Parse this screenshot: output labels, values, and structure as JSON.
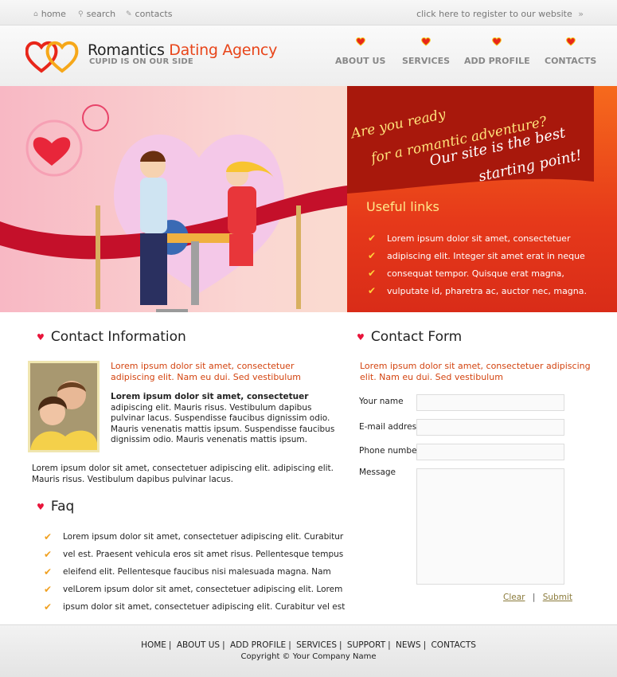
{
  "topbar": {
    "links": [
      {
        "label": "home",
        "icon": "home-icon"
      },
      {
        "label": "search",
        "icon": "search-icon"
      },
      {
        "label": "contacts",
        "icon": "pencil-icon"
      }
    ],
    "register": "click here to register to our website",
    "register_icon": "»"
  },
  "header": {
    "logo_title_a": "Romantics",
    "logo_title_b": "Dating Agency",
    "logo_sub": "CUPID IS ON OUR SIDE",
    "nav": [
      "ABOUT US",
      "SERVICES",
      "ADD PROFILE",
      "CONTACTS"
    ]
  },
  "banner": {
    "tagline": [
      "Are you ready",
      "for a romantic adventure?",
      "Our site is the best",
      "starting point!"
    ],
    "useful_title": "Useful links",
    "useful_links": [
      "Lorem ipsum dolor sit amet, consectetuer",
      "adipiscing elit. Integer sit amet erat in neque",
      "consequat tempor. Quisque erat magna,",
      "vulputate id, pharetra ac, auctor nec, magna."
    ]
  },
  "contact_info": {
    "title": "Contact Information",
    "intro": [
      "Lorem ipsum dolor sit amet, consectetuer",
      "adipiscing elit. Nam eu dui. Sed vestibulum"
    ],
    "bold": "Lorem ipsum dolor sit amet, consectetuer",
    "paragraph": [
      "adipiscing elit. Mauris risus. Vestibulum dapibus",
      "pulvinar lacus. Suspendisse faucibus dignissim odio.",
      "Mauris venenatis mattis ipsum.  Suspendisse faucibus",
      "dignissim odio. Mauris venenatis mattis ipsum."
    ],
    "extra": [
      "Lorem ipsum dolor sit amet, consectetuer adipiscing elit. adipiscing elit.",
      "Mauris risus. Vestibulum dapibus pulvinar lacus."
    ]
  },
  "faq": {
    "title": "Faq",
    "items": [
      "Lorem ipsum dolor sit amet, consectetuer adipiscing elit. Curabitur",
      "vel est. Praesent vehicula eros sit amet risus. Pellentesque tempus",
      "eleifend elit. Pellentesque faucibus nisi malesuada magna. Nam",
      "velLorem ipsum dolor sit amet, consectetuer adipiscing elit. Lorem",
      "ipsum dolor sit amet, consectetuer adipiscing elit. Curabitur vel est"
    ]
  },
  "contact_form": {
    "title": "Contact Form",
    "intro": [
      "Lorem ipsum dolor sit amet, consectetuer adipiscing",
      "elit. Nam eu dui. Sed vestibulum"
    ],
    "labels": {
      "name": "Your name",
      "email": "E-mail address",
      "phone": "Phone number",
      "message": "Message"
    },
    "clear": "Clear",
    "submit": "Submit",
    "divider": "|"
  },
  "footer": {
    "nav": [
      "HOME",
      "ABOUT US",
      "ADD PROFILE",
      "SERVICES",
      "SUPPORT",
      "NEWS",
      "CONTACTS"
    ],
    "copyright": "Copyright © Your Company Name"
  },
  "colors": {
    "accent": "#e8451a",
    "banner_orange": "#f2581a",
    "heart": "#e8143a"
  }
}
